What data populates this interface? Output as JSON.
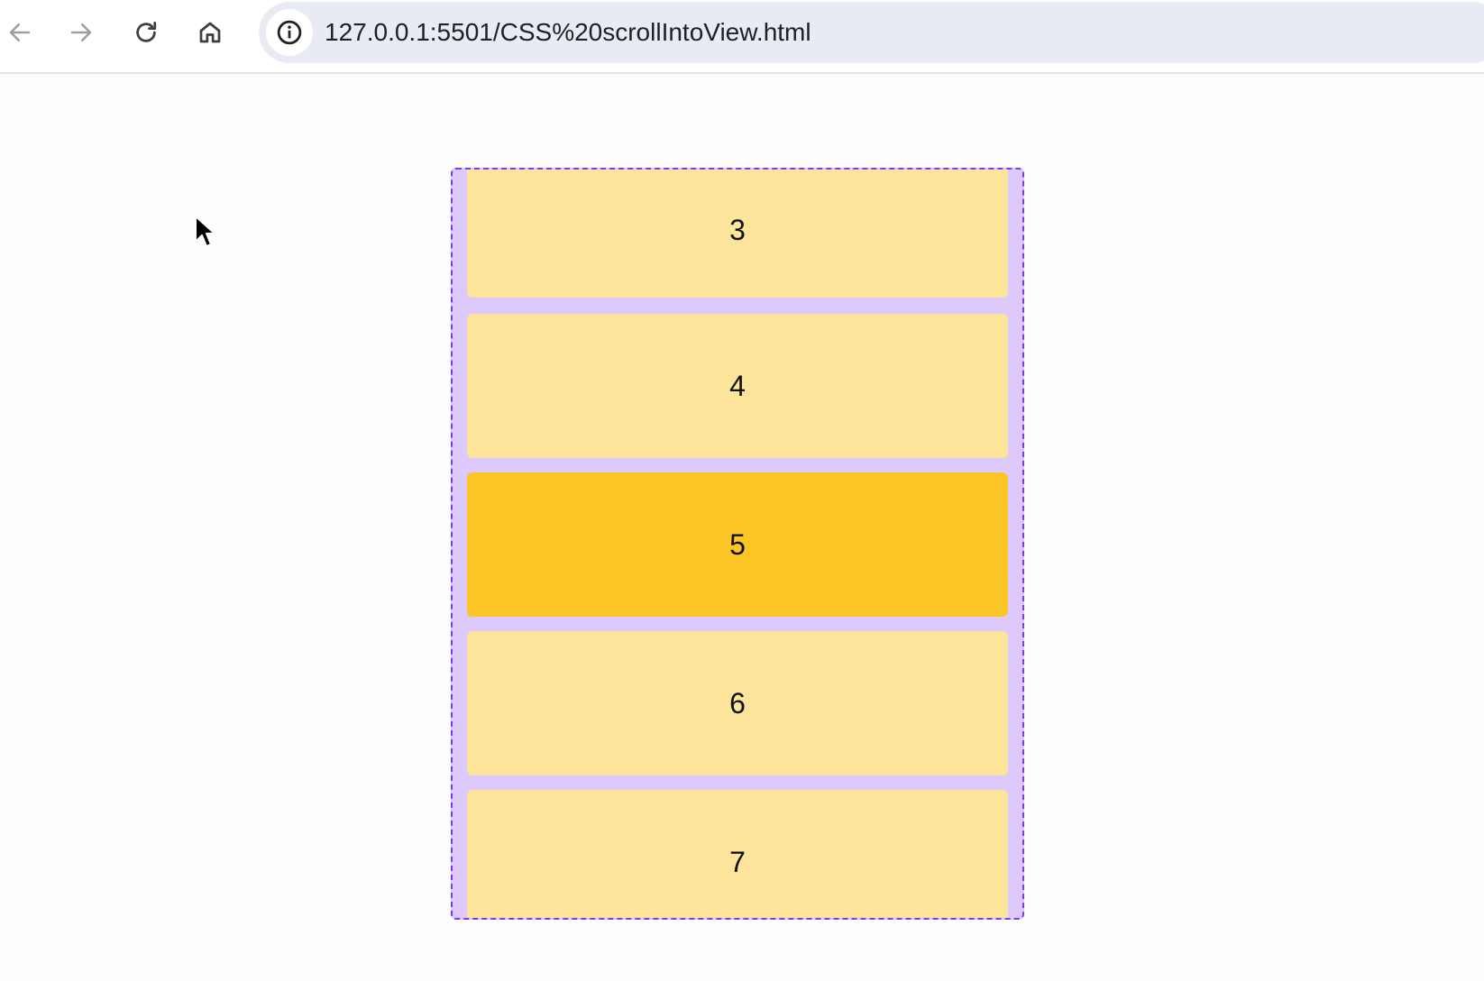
{
  "browser": {
    "back_icon": "arrow-left-icon",
    "forward_icon": "arrow-right-icon",
    "reload_icon": "reload-icon",
    "home_icon": "home-icon",
    "site_info_icon": "info-circle-icon",
    "url": "127.0.0.1:5501/CSS%20scrollIntoView.html"
  },
  "scroller": {
    "border_color": "#7c3aed",
    "background_color": "#ddc9fb",
    "items": [
      {
        "label": "3",
        "active": false
      },
      {
        "label": "4",
        "active": false
      },
      {
        "label": "5",
        "active": true
      },
      {
        "label": "6",
        "active": false
      },
      {
        "label": "7",
        "active": false
      }
    ],
    "item_color": "#fde49b",
    "active_item_color": "#fcc526"
  },
  "cursor_icon": "mouse-pointer-icon"
}
